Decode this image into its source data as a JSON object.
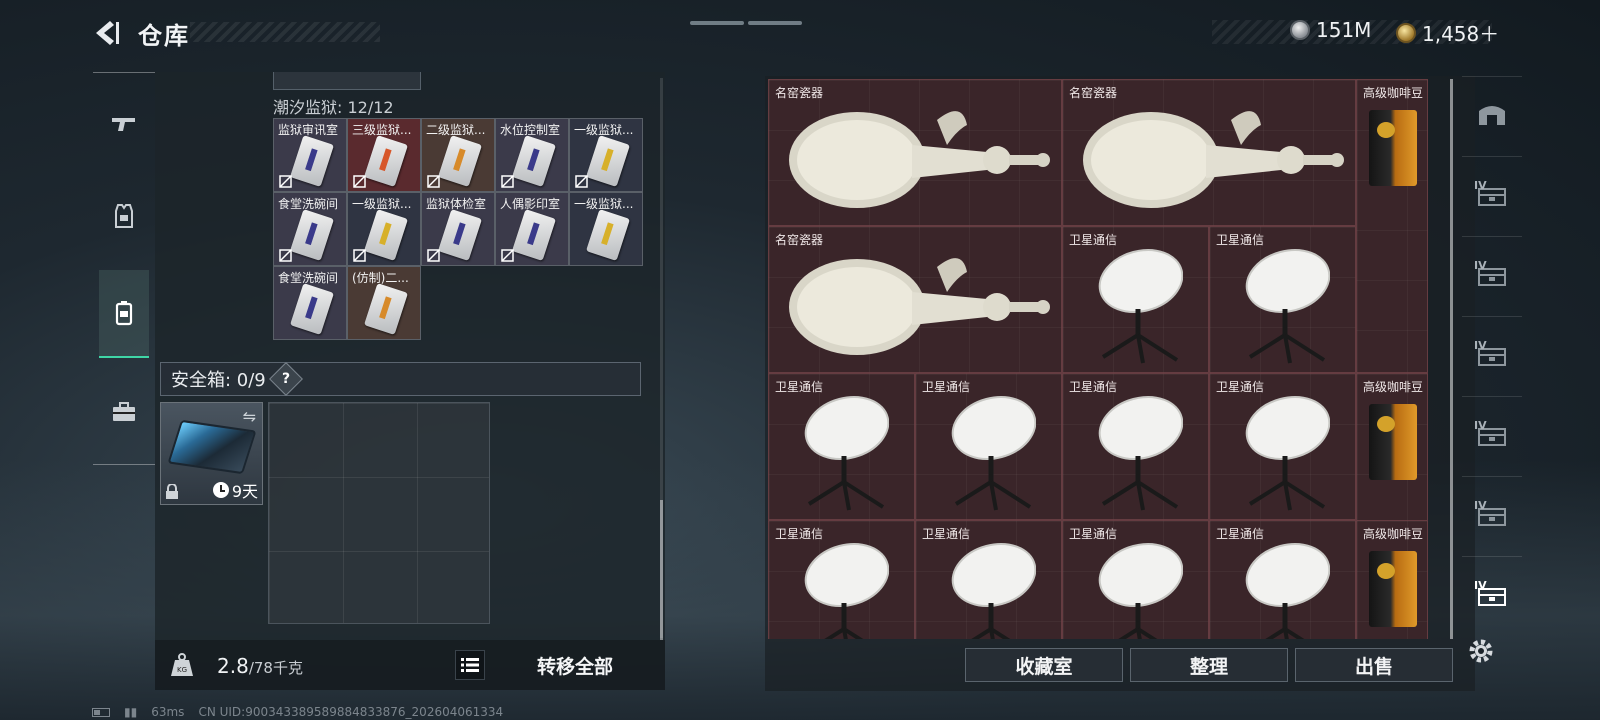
{
  "header": {
    "title": "仓库",
    "currency_silver": "151M",
    "currency_gold": "1,458＋"
  },
  "left_nav": {
    "items": [
      "weapon-icon",
      "armor-icon",
      "backpack-icon",
      "toolbox-icon"
    ],
    "active_index": 2
  },
  "container": {
    "label": "潮汐监狱: 12/12",
    "keys": [
      {
        "label": "监狱审讯室",
        "stripe": "#3a3a8a",
        "bg": "#3b3a4a"
      },
      {
        "label": "三级监狱...",
        "stripe": "#d7572a",
        "bg": "#5a2a2e"
      },
      {
        "label": "二级监狱...",
        "stripe": "#d78a2a",
        "bg": "#4a3a34"
      },
      {
        "label": "水位控制室",
        "stripe": "#3a3a8a",
        "bg": "#3b3a4a"
      },
      {
        "label": "一级监狱...",
        "stripe": "#d7b02a",
        "bg": "#2f3442"
      },
      {
        "label": "食堂洗碗间",
        "stripe": "#3a3a8a",
        "bg": "#3b3a4a"
      },
      {
        "label": "一级监狱...",
        "stripe": "#d7b02a",
        "bg": "#2f3442"
      },
      {
        "label": "监狱体检室",
        "stripe": "#3a3a8a",
        "bg": "#3b3a4a"
      },
      {
        "label": "人偶影印室",
        "stripe": "#3a3a8a",
        "bg": "#3b3a4a"
      },
      {
        "label": "一级监狱...",
        "stripe": "#d7b02a",
        "bg": "#2f3442"
      },
      {
        "label": "食堂洗碗间",
        "stripe": "#3a3a8a",
        "bg": "#3b3a4a"
      },
      {
        "label": "(仿制)二...",
        "stripe": "#d78a2a",
        "bg": "#4a3a34"
      }
    ]
  },
  "safe": {
    "label": "安全箱: 0/9",
    "help": "?",
    "duration": "9天"
  },
  "weight": {
    "current": "2.8",
    "max_unit": "/78千克"
  },
  "buttons": {
    "transfer_all": "转移全部",
    "collection": "收藏室",
    "organize": "整理",
    "sell": "出售"
  },
  "stash": {
    "vase_label": "名窑瓷器",
    "satellite_label": "卫星通信",
    "coffee_label": "高级咖啡豆"
  },
  "right_nav": {
    "items": [
      "home-icon",
      "storage-tier-icon",
      "storage-tier-icon",
      "storage-tier-icon",
      "storage-tier-icon",
      "storage-tier-icon",
      "storage-tier-icon"
    ],
    "tier_label": "IV"
  },
  "status": {
    "ping": "63ms",
    "uid": "CN UID:900343389589884833876_202604061334"
  },
  "colors": {
    "accent": "#3fd6a6",
    "stash_cell": "#3a2529"
  }
}
